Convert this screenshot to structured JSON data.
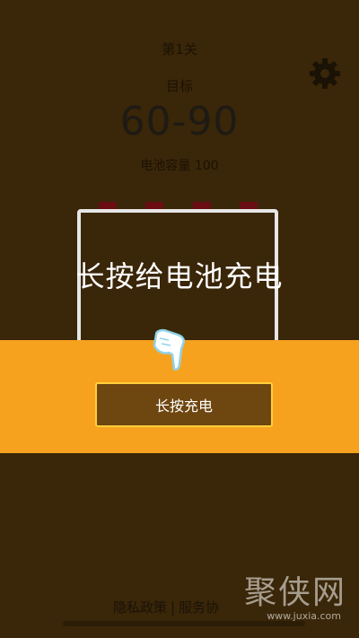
{
  "level": {
    "label": "第1关"
  },
  "target": {
    "label": "目标",
    "range": "60-90"
  },
  "battery": {
    "capacity_label": "电池容量 100",
    "charge_fraction": 0
  },
  "overlay": {
    "instruction": "长按给电池充电"
  },
  "charge_button": {
    "label": "长按充电"
  },
  "footer": {
    "privacy": "隐私政策",
    "separator": "|",
    "service": "服务协"
  },
  "watermark": {
    "main": "聚侠网",
    "url": "www.juxia.com"
  },
  "icons": {
    "settings": "gear-icon",
    "pointer": "pointing-hand-icon"
  },
  "colors": {
    "background": "#3a2608",
    "band": "#f7a21e",
    "button_fill": "#6e4610",
    "button_border": "#ffcf3a",
    "terminal": "#6a0e14"
  }
}
